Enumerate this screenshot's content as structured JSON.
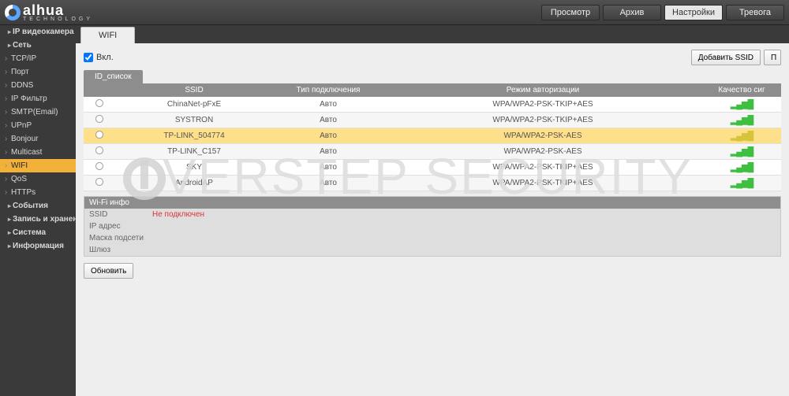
{
  "brand": {
    "name": "alhua",
    "sub": "TECHNOLOGY"
  },
  "topnav": {
    "view": "Просмотр",
    "archive": "Архив",
    "settings": "Настройки",
    "alarm": "Тревога"
  },
  "sidebar": {
    "groups": [
      {
        "label": "IP видеокамера",
        "items": []
      },
      {
        "label": "Сеть",
        "items": [
          {
            "label": "TCP/IP"
          },
          {
            "label": "Порт"
          },
          {
            "label": "DDNS"
          },
          {
            "label": "IP Фильтр"
          },
          {
            "label": "SMTP(Email)"
          },
          {
            "label": "UPnP"
          },
          {
            "label": "Bonjour"
          },
          {
            "label": "Multicast"
          },
          {
            "label": "WIFI",
            "active": true
          },
          {
            "label": "QoS"
          },
          {
            "label": "HTTPs"
          }
        ]
      },
      {
        "label": "События",
        "items": []
      },
      {
        "label": "Запись и хранение",
        "items": []
      },
      {
        "label": "Система",
        "items": []
      },
      {
        "label": "Информация",
        "items": []
      }
    ]
  },
  "tab": {
    "label": "WIFI"
  },
  "enable": {
    "label": "Вкл."
  },
  "buttons": {
    "addssid": "Добавить SSID",
    "search": "П",
    "refresh": "Обновить"
  },
  "subtab": {
    "label": "ID_список"
  },
  "columns": {
    "ssid": "SSID",
    "conn": "Тип подключения",
    "auth": "Режим авторизации",
    "signal": "Качество сиг"
  },
  "rows": [
    {
      "ssid": "ChinaNet-pFxE",
      "conn": "Авто",
      "auth": "WPA/WPA2-PSK-TKIP+AES",
      "sig": "g"
    },
    {
      "ssid": "SYSTRON",
      "conn": "Авто",
      "auth": "WPA/WPA2-PSK-TKIP+AES",
      "sig": "g"
    },
    {
      "ssid": "TP-LINK_504774",
      "conn": "Авто",
      "auth": "WPA/WPA2-PSK-AES",
      "sig": "y",
      "sel": true
    },
    {
      "ssid": "TP-LINK_C157",
      "conn": "Авто",
      "auth": "WPA/WPA2-PSK-AES",
      "sig": "g"
    },
    {
      "ssid": "SKY",
      "conn": "Авто",
      "auth": "WPA/WPA2-PSK-TKIP+AES",
      "sig": "g"
    },
    {
      "ssid": "AndroidAP",
      "conn": "Авто",
      "auth": "WPA/WPA2-PSK-TKIP+AES",
      "sig": "g"
    }
  ],
  "info": {
    "title": "Wi-Fi инфо",
    "status": {
      "k": "SSID",
      "v": "Не подключен"
    },
    "ip": {
      "k": "IP адрес",
      "v": ""
    },
    "mask": {
      "k": "Маска подсети",
      "v": ""
    },
    "gw": {
      "k": "Шлюз",
      "v": ""
    }
  },
  "watermark": "OVERSTEP SECURITY"
}
